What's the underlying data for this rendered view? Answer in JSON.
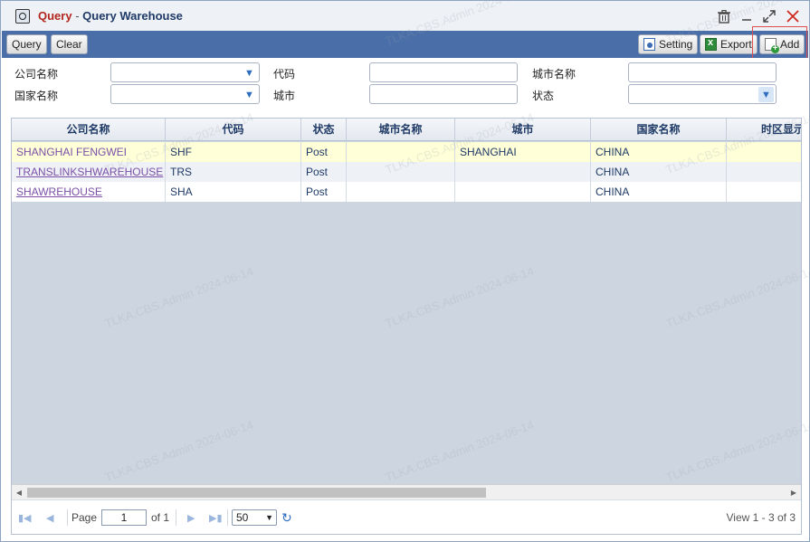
{
  "window": {
    "title_prefix": "Query",
    "title_sep": " - ",
    "title_main": "Query Warehouse"
  },
  "titlebar_icons": [
    "trash-icon",
    "minimize-icon",
    "maximize-icon",
    "close-icon"
  ],
  "toolbar": {
    "query_label": "Query",
    "clear_label": "Clear",
    "setting_label": "Setting",
    "export_label": "Export",
    "add_label": "Add"
  },
  "filter": {
    "company_name": "公司名称",
    "code": "代码",
    "city_name": "城市名称",
    "country_name": "国家名称",
    "city": "城市",
    "status": "状态"
  },
  "grid": {
    "columns": [
      "公司名称",
      "代码",
      "状态",
      "城市名称",
      "城市",
      "国家名称",
      "时区显示"
    ],
    "rows": [
      {
        "company": "SHANGHAI FENGWEI",
        "code": "SHF",
        "status": "Post",
        "city_name": "",
        "city": "SHANGHAI",
        "country": "CHINA"
      },
      {
        "company": "TRANSLINKSHWAREHOUSE",
        "code": "TRS",
        "status": "Post",
        "city_name": "",
        "city": "",
        "country": "CHINA"
      },
      {
        "company": "SHAWREHOUSE",
        "code": "SHA",
        "status": "Post",
        "city_name": "",
        "city": "",
        "country": "CHINA"
      }
    ]
  },
  "pager": {
    "page_label": "Page",
    "page_value": "1",
    "of_label": "of 1",
    "page_size": "50",
    "view_text": "View 1 - 3 of 3"
  },
  "watermark": "TLKA.CBS.Admin 2024-06-14",
  "colors": {
    "toolbar_bg": "#4a6fa8",
    "highlight_row": "#ffffd8",
    "grid_empty": "#cdd6e0",
    "link": "#7b4fa6"
  }
}
